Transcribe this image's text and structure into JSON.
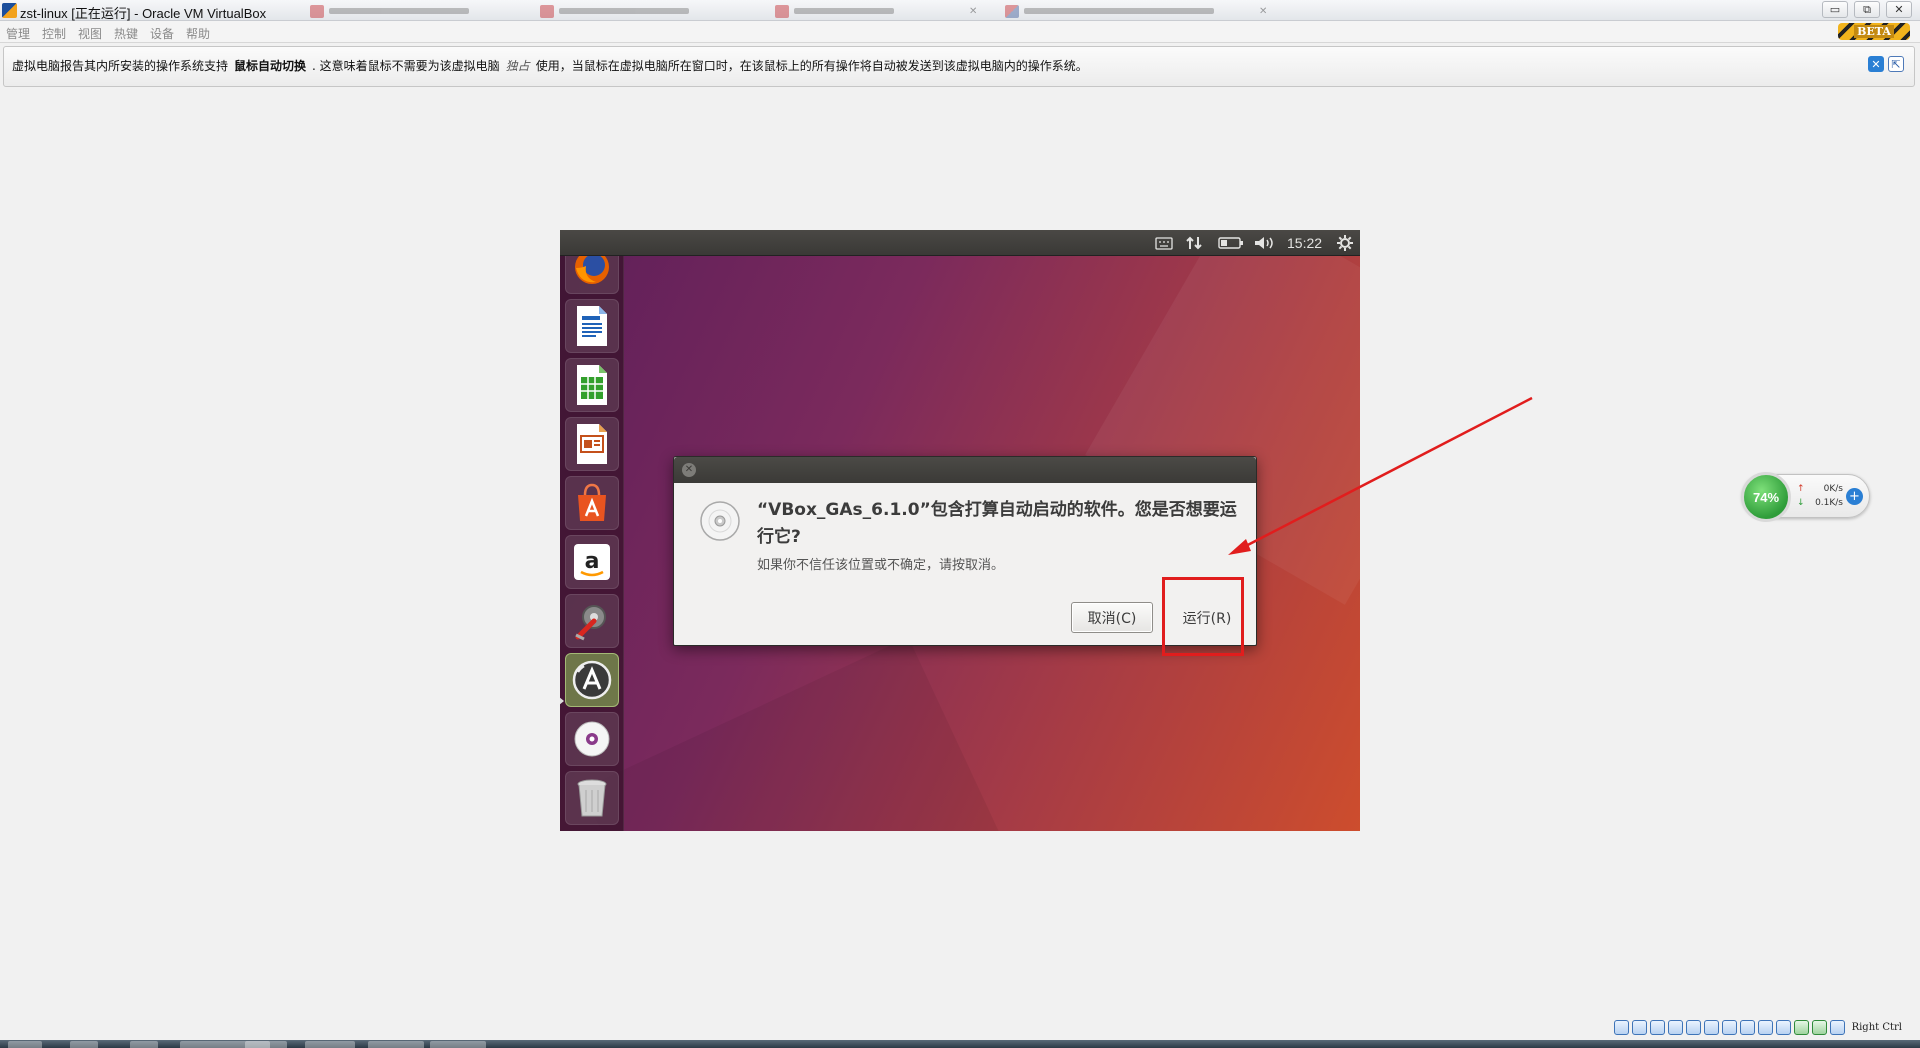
{
  "window": {
    "title": "zst-linux [正在运行] - Oracle VM VirtualBox",
    "controls": {
      "minimize": "▭",
      "restore": "⧉",
      "close": "✕"
    }
  },
  "menubar": {
    "items": [
      "管理",
      "控制",
      "视图",
      "热键",
      "设备",
      "帮助"
    ],
    "beta": "BETA"
  },
  "notice": {
    "part1": "虚拟电脑报告其内所安装的操作系统支持",
    "bold": "鼠标自动切换",
    "part2": ". 这意味着鼠标不需要为该虚拟电脑",
    "captured": "独占",
    "part3": "使用，当鼠标在虚拟电脑所在窗口时，在该鼠标上的所有操作将自动被发送到该虚拟电脑内的操作系统。"
  },
  "ubuntu": {
    "clock": "15:22",
    "launcher": [
      {
        "name": "firefox-icon"
      },
      {
        "name": "writer-icon"
      },
      {
        "name": "calc-icon"
      },
      {
        "name": "impress-icon"
      },
      {
        "name": "software-center-icon"
      },
      {
        "name": "amazon-icon"
      },
      {
        "name": "system-settings-icon"
      },
      {
        "name": "software-updater-icon"
      },
      {
        "name": "cd-disc-icon"
      },
      {
        "name": "trash-icon"
      }
    ]
  },
  "dialog": {
    "title": "“VBox_GAs_6.1.0”包含打算自动启动的软件。您是否想要运行它?",
    "subtitle": "如果你不信任该位置或不确定，请按取消。",
    "cancel_label": "取消(C)",
    "run_label": "运行(R)"
  },
  "net_widget": {
    "percent": "74%",
    "up": "0K/s",
    "down": "0.1K/s"
  },
  "statusbar": {
    "host_key": "Right Ctrl"
  },
  "colors": {
    "annotation_red": "#e11d1d",
    "ubuntu_orange": "#cd4d2d",
    "ubuntu_purple": "#5e1f5a"
  }
}
